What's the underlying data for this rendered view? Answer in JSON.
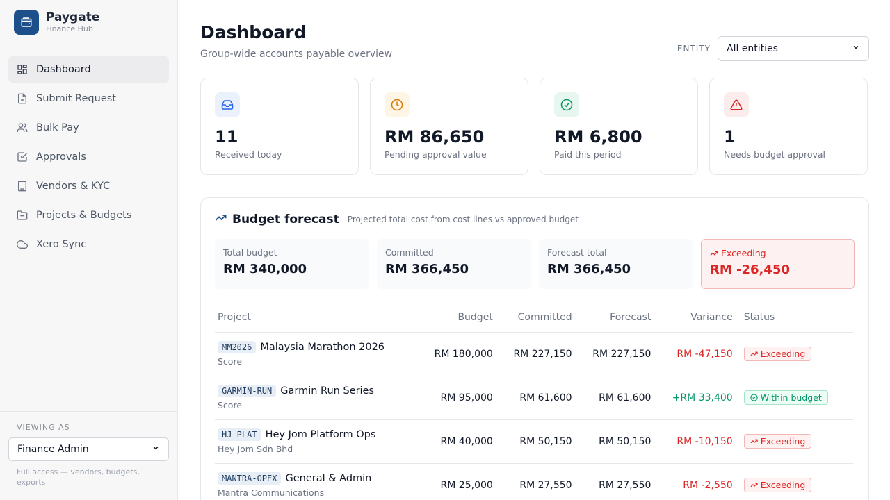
{
  "brand": {
    "name": "Paygate",
    "subtitle": "Finance Hub",
    "icon": "wallet-icon"
  },
  "sidebar": {
    "items": [
      {
        "label": "Dashboard",
        "icon": "dashboard-icon",
        "active": true
      },
      {
        "label": "Submit Request",
        "icon": "file-plus-icon"
      },
      {
        "label": "Bulk Pay",
        "icon": "users-icon"
      },
      {
        "label": "Approvals",
        "icon": "check-square-icon"
      },
      {
        "label": "Vendors & KYC",
        "icon": "building-icon"
      },
      {
        "label": "Projects & Budgets",
        "icon": "folder-icon"
      },
      {
        "label": "Xero Sync",
        "icon": "cloud-icon"
      }
    ],
    "viewing_label": "VIEWING AS",
    "role": "Finance Admin",
    "role_note": "Full access — vendors, budgets, exports"
  },
  "header": {
    "title": "Dashboard",
    "subtitle": "Group-wide accounts payable overview",
    "entity_label": "ENTITY",
    "entity_value": "All entities"
  },
  "stats": [
    {
      "value": "11",
      "label": "Received today",
      "icon": "inbox-icon",
      "color": "#2563eb",
      "bg": "#eaf1fd"
    },
    {
      "value": "RM 86,650",
      "label": "Pending approval value",
      "icon": "clock-icon",
      "color": "#d97706",
      "bg": "#fef5e4"
    },
    {
      "value": "RM 6,800",
      "label": "Paid this period",
      "icon": "check-circle-icon",
      "color": "#059669",
      "bg": "#e7f7ef"
    },
    {
      "value": "1",
      "label": "Needs budget approval",
      "icon": "alert-triangle-icon",
      "color": "#dc2626",
      "bg": "#fdecec"
    }
  ],
  "forecast": {
    "title": "Budget forecast",
    "subtitle": "Projected total cost from cost lines vs approved budget",
    "summary": [
      {
        "label": "Total budget",
        "value": "RM 340,000"
      },
      {
        "label": "Committed",
        "value": "RM 366,450"
      },
      {
        "label": "Forecast total",
        "value": "RM 366,450"
      },
      {
        "label": "Exceeding",
        "value": "RM -26,450"
      }
    ],
    "columns": [
      "Project",
      "Budget",
      "Committed",
      "Forecast",
      "Variance",
      "Status"
    ],
    "rows": [
      {
        "code": "MM2026",
        "name": "Malaysia Marathon 2026",
        "company": "Score",
        "budget": "RM 180,000",
        "committed": "RM 227,150",
        "forecast": "RM 227,150",
        "variance": "RM -47,150",
        "status": "Exceeding"
      },
      {
        "code": "GARMIN-RUN",
        "name": "Garmin Run Series",
        "company": "Score",
        "budget": "RM 95,000",
        "committed": "RM 61,600",
        "forecast": "RM 61,600",
        "variance": "+RM 33,400",
        "status": "Within budget"
      },
      {
        "code": "HJ-PLAT",
        "name": "Hey Jom Platform Ops",
        "company": "Hey Jom Sdn Bhd",
        "budget": "RM 40,000",
        "committed": "RM 50,150",
        "forecast": "RM 50,150",
        "variance": "RM -10,150",
        "status": "Exceeding"
      },
      {
        "code": "MANTRA-OPEX",
        "name": "General & Admin",
        "company": "Mantra Communications",
        "budget": "RM 25,000",
        "committed": "RM 27,550",
        "forecast": "RM 27,550",
        "variance": "RM -2,550",
        "status": "Exceeding"
      }
    ]
  }
}
